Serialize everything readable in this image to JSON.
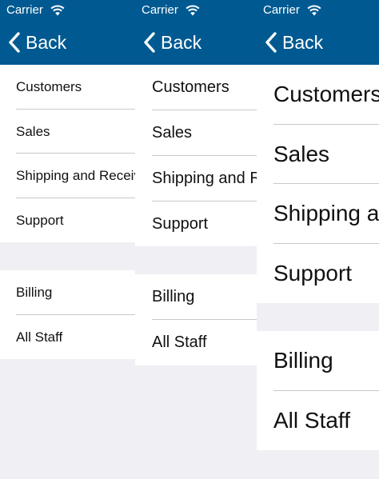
{
  "status_bar": {
    "carrier": "Carrier"
  },
  "nav": {
    "back_label": "Back"
  },
  "colors": {
    "navbar": "#005a91",
    "background": "#efeff4",
    "separator": "#c8c7cc"
  },
  "list": {
    "group1": [
      "Customers",
      "Sales",
      "Shipping and Receiving",
      "Support"
    ],
    "group2": [
      "Billing",
      "All Staff"
    ]
  }
}
